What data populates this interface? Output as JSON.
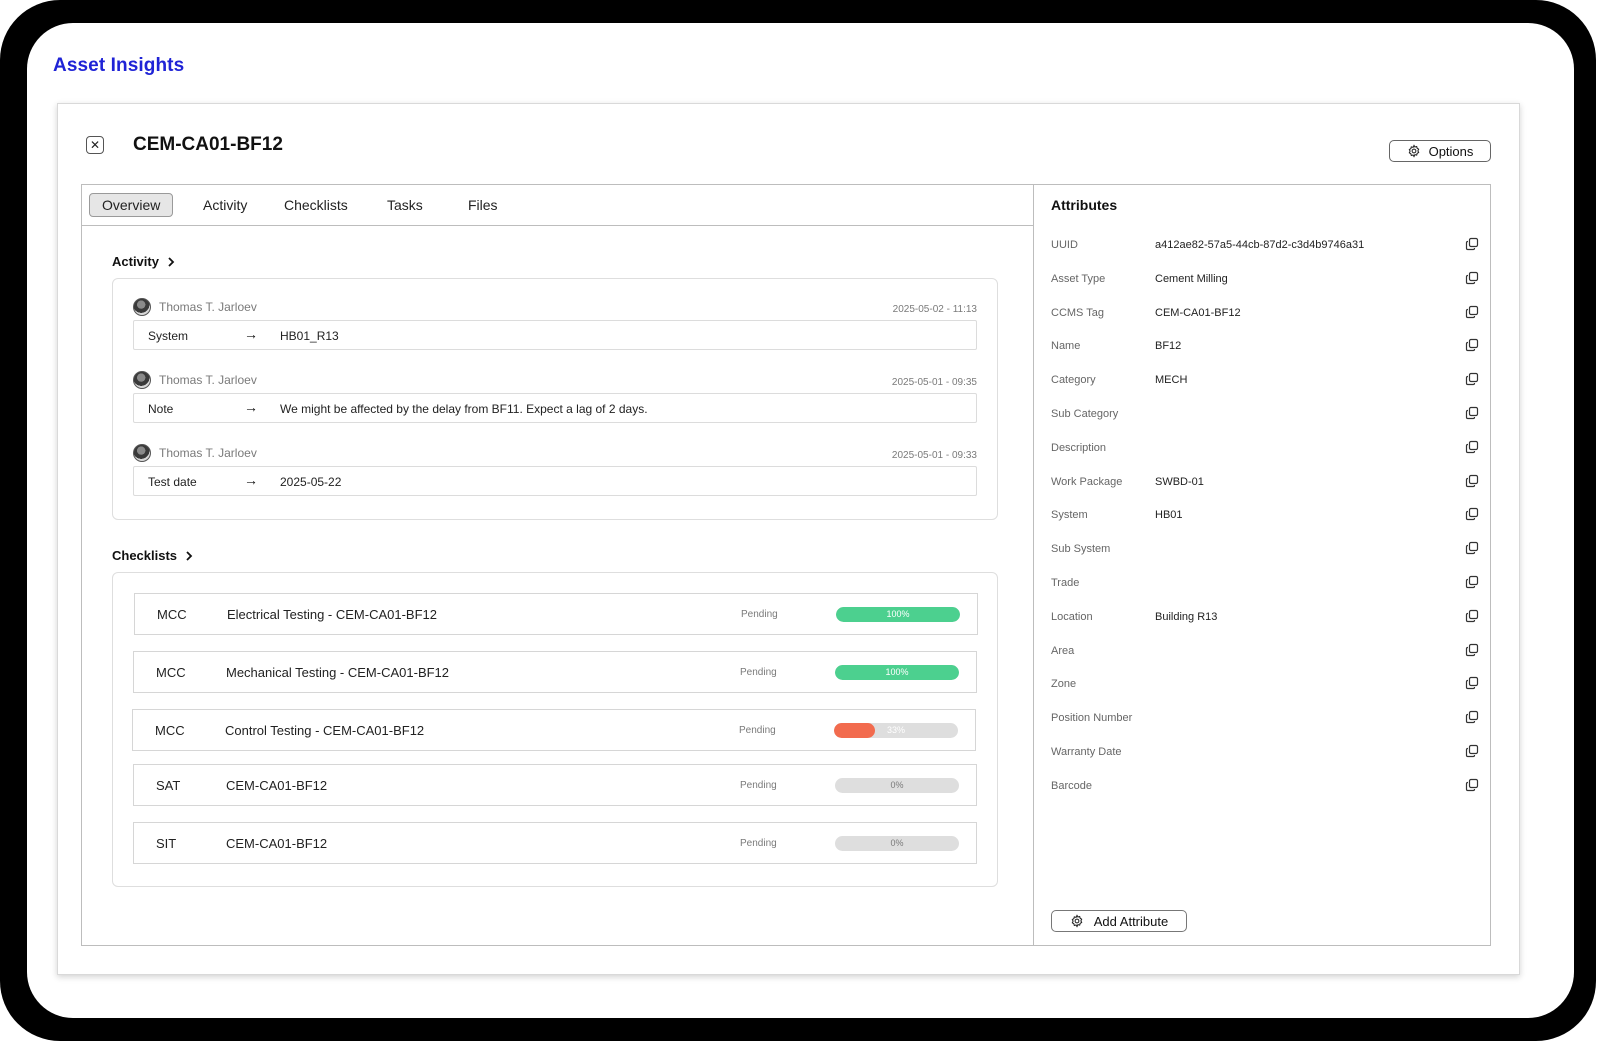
{
  "app": {
    "title": "Asset Insights"
  },
  "asset": {
    "title": "CEM-CA01-BF12",
    "close_glyph": "✕",
    "options_label": "Options"
  },
  "tabs": [
    {
      "label": "Overview",
      "active": true
    },
    {
      "label": "Activity",
      "active": false
    },
    {
      "label": "Checklists",
      "active": false
    },
    {
      "label": "Tasks",
      "active": false
    },
    {
      "label": "Files",
      "active": false
    }
  ],
  "activity": {
    "heading": "Activity",
    "entries": [
      {
        "user": "Thomas T. Jarloev",
        "time": "2025-05-02 - 11:13",
        "field": "System",
        "arrow": "→",
        "value": "HB01_R13"
      },
      {
        "user": "Thomas T. Jarloev",
        "time": "2025-05-01 - 09:35",
        "field": "Note",
        "arrow": "→",
        "value": "We might be affected by the delay from BF11. Expect a lag of 2 days."
      },
      {
        "user": "Thomas T. Jarloev",
        "time": "2025-05-01 - 09:33",
        "field": "Test date",
        "arrow": "→",
        "value": "2025-05-22"
      }
    ]
  },
  "checklists": {
    "heading": "Checklists",
    "items": [
      {
        "code": "MCC",
        "name": "Electrical Testing - CEM-CA01-BF12",
        "status": "Pending",
        "progress": 100,
        "progress_label": "100%",
        "color": "#4cd08f"
      },
      {
        "code": "MCC",
        "name": "Mechanical Testing - CEM-CA01-BF12",
        "status": "Pending",
        "progress": 100,
        "progress_label": "100%",
        "color": "#4cd08f"
      },
      {
        "code": "MCC",
        "name": "Control Testing - CEM-CA01-BF12",
        "status": "Pending",
        "progress": 33,
        "progress_label": "33%",
        "color": "#f26b4e"
      },
      {
        "code": "SAT",
        "name": "CEM-CA01-BF12",
        "status": "Pending",
        "progress": 0,
        "progress_label": "0%",
        "color": "#dedede"
      },
      {
        "code": "SIT",
        "name": "CEM-CA01-BF12",
        "status": "Pending",
        "progress": 0,
        "progress_label": "0%",
        "color": "#dedede"
      }
    ]
  },
  "attributes": {
    "title": "Attributes",
    "add_label": "Add Attribute",
    "rows": [
      {
        "key": "UUID",
        "value": "a412ae82-57a5-44cb-87d2-c3d4b9746a31"
      },
      {
        "key": "Asset Type",
        "value": "Cement Milling"
      },
      {
        "key": "CCMS Tag",
        "value": "CEM-CA01-BF12"
      },
      {
        "key": "Name",
        "value": "BF12"
      },
      {
        "key": "Category",
        "value": "MECH"
      },
      {
        "key": "Sub Category",
        "value": ""
      },
      {
        "key": "Description",
        "value": ""
      },
      {
        "key": "Work Package",
        "value": "SWBD-01"
      },
      {
        "key": "System",
        "value": "HB01"
      },
      {
        "key": "Sub System",
        "value": ""
      },
      {
        "key": "Trade",
        "value": ""
      },
      {
        "key": "Location",
        "value": "Building R13"
      },
      {
        "key": "Area",
        "value": ""
      },
      {
        "key": "Zone",
        "value": ""
      },
      {
        "key": "Position Number",
        "value": ""
      },
      {
        "key": "Warranty Date",
        "value": ""
      },
      {
        "key": "Barcode",
        "value": ""
      }
    ]
  },
  "icons": {
    "close": "close-icon",
    "options": "gear-icon",
    "copy": "copy-icon",
    "chevron": "chevron-right-icon",
    "arrow": "arrow-right-icon"
  },
  "colors": {
    "brand": "#1f23d6",
    "complete": "#4cd08f",
    "behind": "#f26b4e",
    "empty": "#dedede"
  }
}
